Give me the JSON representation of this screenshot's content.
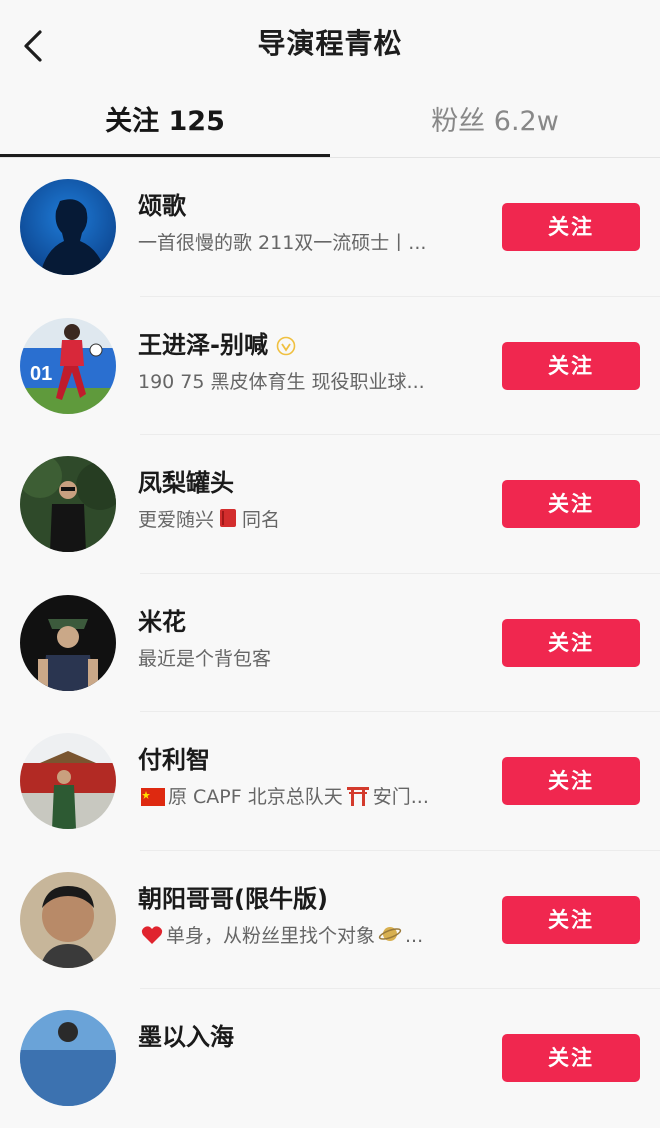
{
  "header": {
    "title": "导演程青松",
    "back_icon": "chevron-left-icon"
  },
  "tabs": [
    {
      "label": "关注 125",
      "active": true
    },
    {
      "label": "粉丝 6.2w",
      "active": false
    }
  ],
  "colors": {
    "accent": "#f0274f",
    "text_primary": "#1a1a1a",
    "text_secondary": "#666666",
    "tab_inactive": "#888888"
  },
  "users": [
    {
      "name": "颂歌",
      "bio": "一首很慢的歌  211双一流硕士丨...",
      "button": "关注",
      "verified": false,
      "avatar": "avatar-silhouette-blue"
    },
    {
      "name": "王进泽-别喊",
      "bio": "190 75 黑皮体育生 现役职业球...",
      "button": "关注",
      "verified": true,
      "avatar": "avatar-football-player"
    },
    {
      "name": "凤梨罐头",
      "bio_pre": "更爱随兴",
      "bio_emoji": "book-icon",
      "bio_post": "同名",
      "button": "关注",
      "verified": false,
      "avatar": "avatar-man-trees"
    },
    {
      "name": "米花",
      "bio": "最近是个背包客",
      "button": "关注",
      "verified": false,
      "avatar": "avatar-man-cap"
    },
    {
      "name": "付利智",
      "bio_emoji": "china-flag-icon",
      "bio_pre": "原 CAPF 北京总队天",
      "bio_emoji2": "torii-gate-icon",
      "bio_post": "安门...",
      "button": "关注",
      "verified": false,
      "avatar": "avatar-soldier-tiananmen"
    },
    {
      "name": "朝阳哥哥(限牛版)",
      "bio_emoji": "heart-icon",
      "bio_pre": "单身，从粉丝里找个对象",
      "bio_emoji2": "planet-icon",
      "bio_post": "...",
      "button": "关注",
      "verified": false,
      "avatar": "avatar-man-portrait"
    },
    {
      "name": "墨以入海",
      "button": "关注",
      "verified": false,
      "avatar": "avatar-partial"
    }
  ]
}
